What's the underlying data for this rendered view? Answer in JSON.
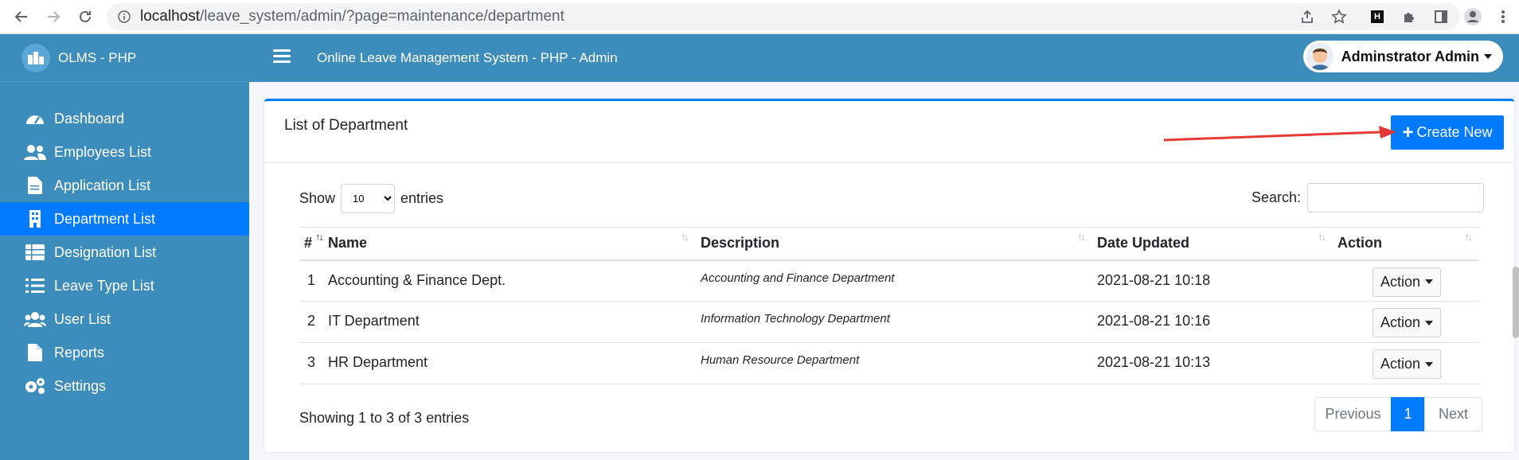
{
  "browser": {
    "url_host": "localhost",
    "url_path": "/leave_system/admin/?page=maintenance/department"
  },
  "sidebar": {
    "brand": "OLMS - PHP",
    "items": [
      {
        "label": "Dashboard",
        "icon": "dashboard-icon"
      },
      {
        "label": "Employees List",
        "icon": "users-icon"
      },
      {
        "label": "Application List",
        "icon": "file-icon"
      },
      {
        "label": "Department List",
        "icon": "building-icon",
        "active": true
      },
      {
        "label": "Designation List",
        "icon": "table-icon"
      },
      {
        "label": "Leave Type List",
        "icon": "list-icon"
      },
      {
        "label": "User List",
        "icon": "users-group-icon"
      },
      {
        "label": "Reports",
        "icon": "report-icon"
      },
      {
        "label": "Settings",
        "icon": "gears-icon"
      }
    ]
  },
  "topbar": {
    "title": "Online Leave Management System - PHP - Admin",
    "user_name": "Adminstrator Admin"
  },
  "card": {
    "title": "List of Department",
    "create_label": "Create New",
    "show_label": "Show",
    "entries_label": "entries",
    "page_size": "10",
    "search_label": "Search:",
    "columns": [
      "#",
      "Name",
      "Description",
      "Date Updated",
      "Action"
    ],
    "rows": [
      {
        "num": "1",
        "name": "Accounting & Finance Dept.",
        "desc": "Accounting and Finance Department",
        "date": "2021-08-21 10:18",
        "action": "Action"
      },
      {
        "num": "2",
        "name": "IT Department",
        "desc": "Information Technology Department",
        "date": "2021-08-21 10:16",
        "action": "Action"
      },
      {
        "num": "3",
        "name": "HR Department",
        "desc": "Human Resource Department",
        "date": "2021-08-21 10:13",
        "action": "Action"
      }
    ],
    "info": "Showing 1 to 3 of 3 entries",
    "pager": {
      "previous": "Previous",
      "current": "1",
      "next": "Next"
    }
  },
  "colors": {
    "sidebar": "#3c8dbc",
    "primary": "#007bff",
    "arrow": "#e53935"
  }
}
